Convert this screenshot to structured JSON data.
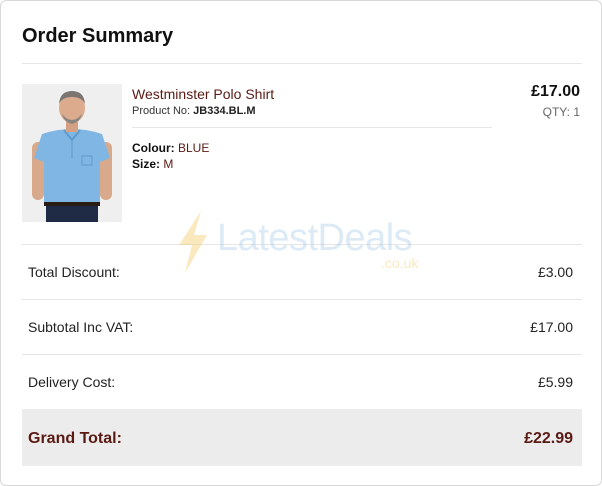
{
  "header": {
    "title": "Order Summary"
  },
  "product": {
    "name": "Westminster Polo Shirt",
    "product_no_label": "Product No:",
    "product_no": "JB334.BL.M",
    "colour_label": "Colour:",
    "colour": "BLUE",
    "size_label": "Size:",
    "size": "M",
    "price": "£17.00",
    "qty": "QTY: 1",
    "image": "man-in-blue-polo-shirt"
  },
  "totals": {
    "discount_label": "Total Discount:",
    "discount": "£3.00",
    "subtotal_label": "Subtotal Inc VAT:",
    "subtotal": "£17.00",
    "delivery_label": "Delivery Cost:",
    "delivery": "£5.99",
    "grand_label": "Grand Total:",
    "grand": "£22.99"
  },
  "watermark": {
    "text": "LatestDeals",
    "sub": ".co.uk"
  },
  "colors": {
    "accent": "#5a1a14",
    "grand_bg": "#ececec",
    "border": "#d9d9d9"
  }
}
